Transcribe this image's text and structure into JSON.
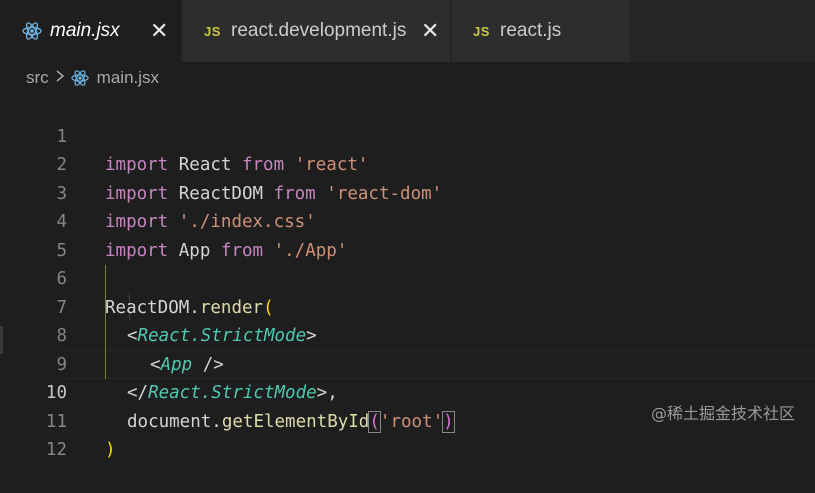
{
  "tabs": {
    "main": {
      "label": "main.jsx"
    },
    "dev": {
      "label": "react.development.js",
      "icon_text": "JS"
    },
    "react": {
      "label": "react.js",
      "icon_text": "JS"
    }
  },
  "breadcrumb": {
    "folder": "src",
    "file": "main.jsx"
  },
  "editor": {
    "active_line": 10,
    "lines": [
      {
        "num": "1"
      },
      {
        "num": "2"
      },
      {
        "num": "3"
      },
      {
        "num": "4"
      },
      {
        "num": "5"
      },
      {
        "num": "6"
      },
      {
        "num": "7"
      },
      {
        "num": "8"
      },
      {
        "num": "9"
      },
      {
        "num": "10"
      },
      {
        "num": "11"
      },
      {
        "num": "12"
      }
    ],
    "tokens": {
      "l1": [
        "import",
        " React ",
        "from",
        " ",
        "'react'"
      ],
      "l2": [
        "import",
        " ReactDOM ",
        "from",
        " ",
        "'react-dom'"
      ],
      "l3": [
        "import",
        " ",
        "'./index.css'"
      ],
      "l4": [
        "import",
        " App ",
        "from",
        " ",
        "'./App'"
      ],
      "l6": [
        "ReactDOM",
        ".",
        "render",
        "("
      ],
      "l7": [
        "<",
        "React.StrictMode",
        ">"
      ],
      "l8": [
        "<",
        "App",
        " />"
      ],
      "l9": [
        "</",
        "React.StrictMode",
        ">,"
      ],
      "l10": [
        "document",
        ".",
        "getElementById",
        "(",
        "'root'",
        ")"
      ],
      "l11": [
        ")"
      ]
    }
  },
  "watermark": "@稀土掘金技术社区",
  "colors": {
    "background": "#1e1e1e",
    "keyword": "#c586c0",
    "string": "#ce9178",
    "function": "#dcdcaa",
    "component": "#4ec9b0",
    "bracket": "#ffd700"
  }
}
